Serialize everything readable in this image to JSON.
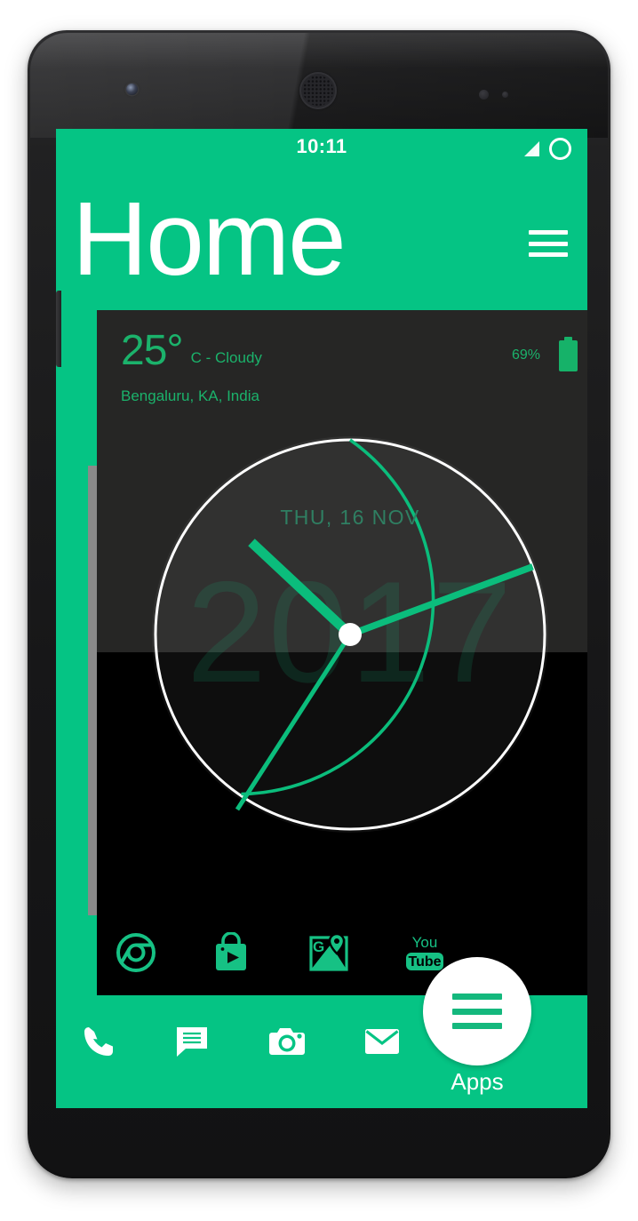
{
  "device": {
    "model_style": "nexus-5-black",
    "icons": {
      "front_camera": "front-camera-icon",
      "earpiece": "earpiece-speaker-icon",
      "proximity_sensor": "proximity-sensor-icon"
    }
  },
  "theme": {
    "accent_green": "#05c484",
    "widget_green": "#1bb26b",
    "panel_dark": "#262625",
    "panel_black": "#000000",
    "rail_gray": "#8a8a8a",
    "white": "#ffffff"
  },
  "status_bar": {
    "time": "10:11",
    "signal_icon": "signal-bars-icon",
    "battery_icon": "battery-ring-icon"
  },
  "header": {
    "title": "Home",
    "menu_icon": "hamburger-menu-icon"
  },
  "weather_widget": {
    "temperature": "25",
    "degree_symbol": "°",
    "condition": "C - Cloudy",
    "location": "Bengaluru,  KA, India",
    "battery_percent": "69%",
    "battery_icon": "battery-icon"
  },
  "clock_widget": {
    "date": "THU, 16 NOV",
    "year": "2017",
    "time_shown": "10:11",
    "hour_hand_angle_deg": -43,
    "minute_hand_angle_deg": 67,
    "second_hand_angle_deg": 214,
    "ring_progress_start_deg": 0,
    "ring_progress_end_deg": 214
  },
  "app_row": {
    "items": [
      {
        "name": "Chrome",
        "icon": "chrome-icon"
      },
      {
        "name": "Play Store",
        "icon": "play-store-icon"
      },
      {
        "name": "Maps",
        "icon": "google-maps-icon"
      },
      {
        "name": "YouTube",
        "icon": "youtube-icon",
        "label_top": "You",
        "label_bottom": "Tube"
      }
    ]
  },
  "dock": {
    "items": [
      {
        "name": "Phone",
        "icon": "phone-icon"
      },
      {
        "name": "Messages",
        "icon": "message-icon"
      },
      {
        "name": "Camera",
        "icon": "camera-icon"
      },
      {
        "name": "Email",
        "icon": "email-icon"
      }
    ],
    "apps_button": {
      "label": "Apps",
      "icon": "hamburger-menu-icon"
    }
  }
}
